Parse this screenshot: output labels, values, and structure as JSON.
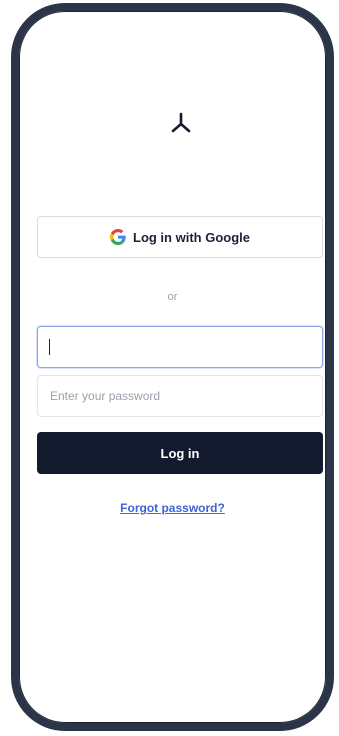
{
  "app": {
    "logo_icon": "tripod-logo-icon",
    "accent_color": "#3f63d8",
    "primary_color": "#141a2e"
  },
  "login": {
    "google_button_label": "Log in with Google",
    "google_icon": "google-g-icon",
    "divider_text": "or",
    "email_value": "",
    "password_placeholder": "Enter your password",
    "password_value": "",
    "submit_label": "Log in",
    "forgot_password_label": "Forgot password?"
  }
}
